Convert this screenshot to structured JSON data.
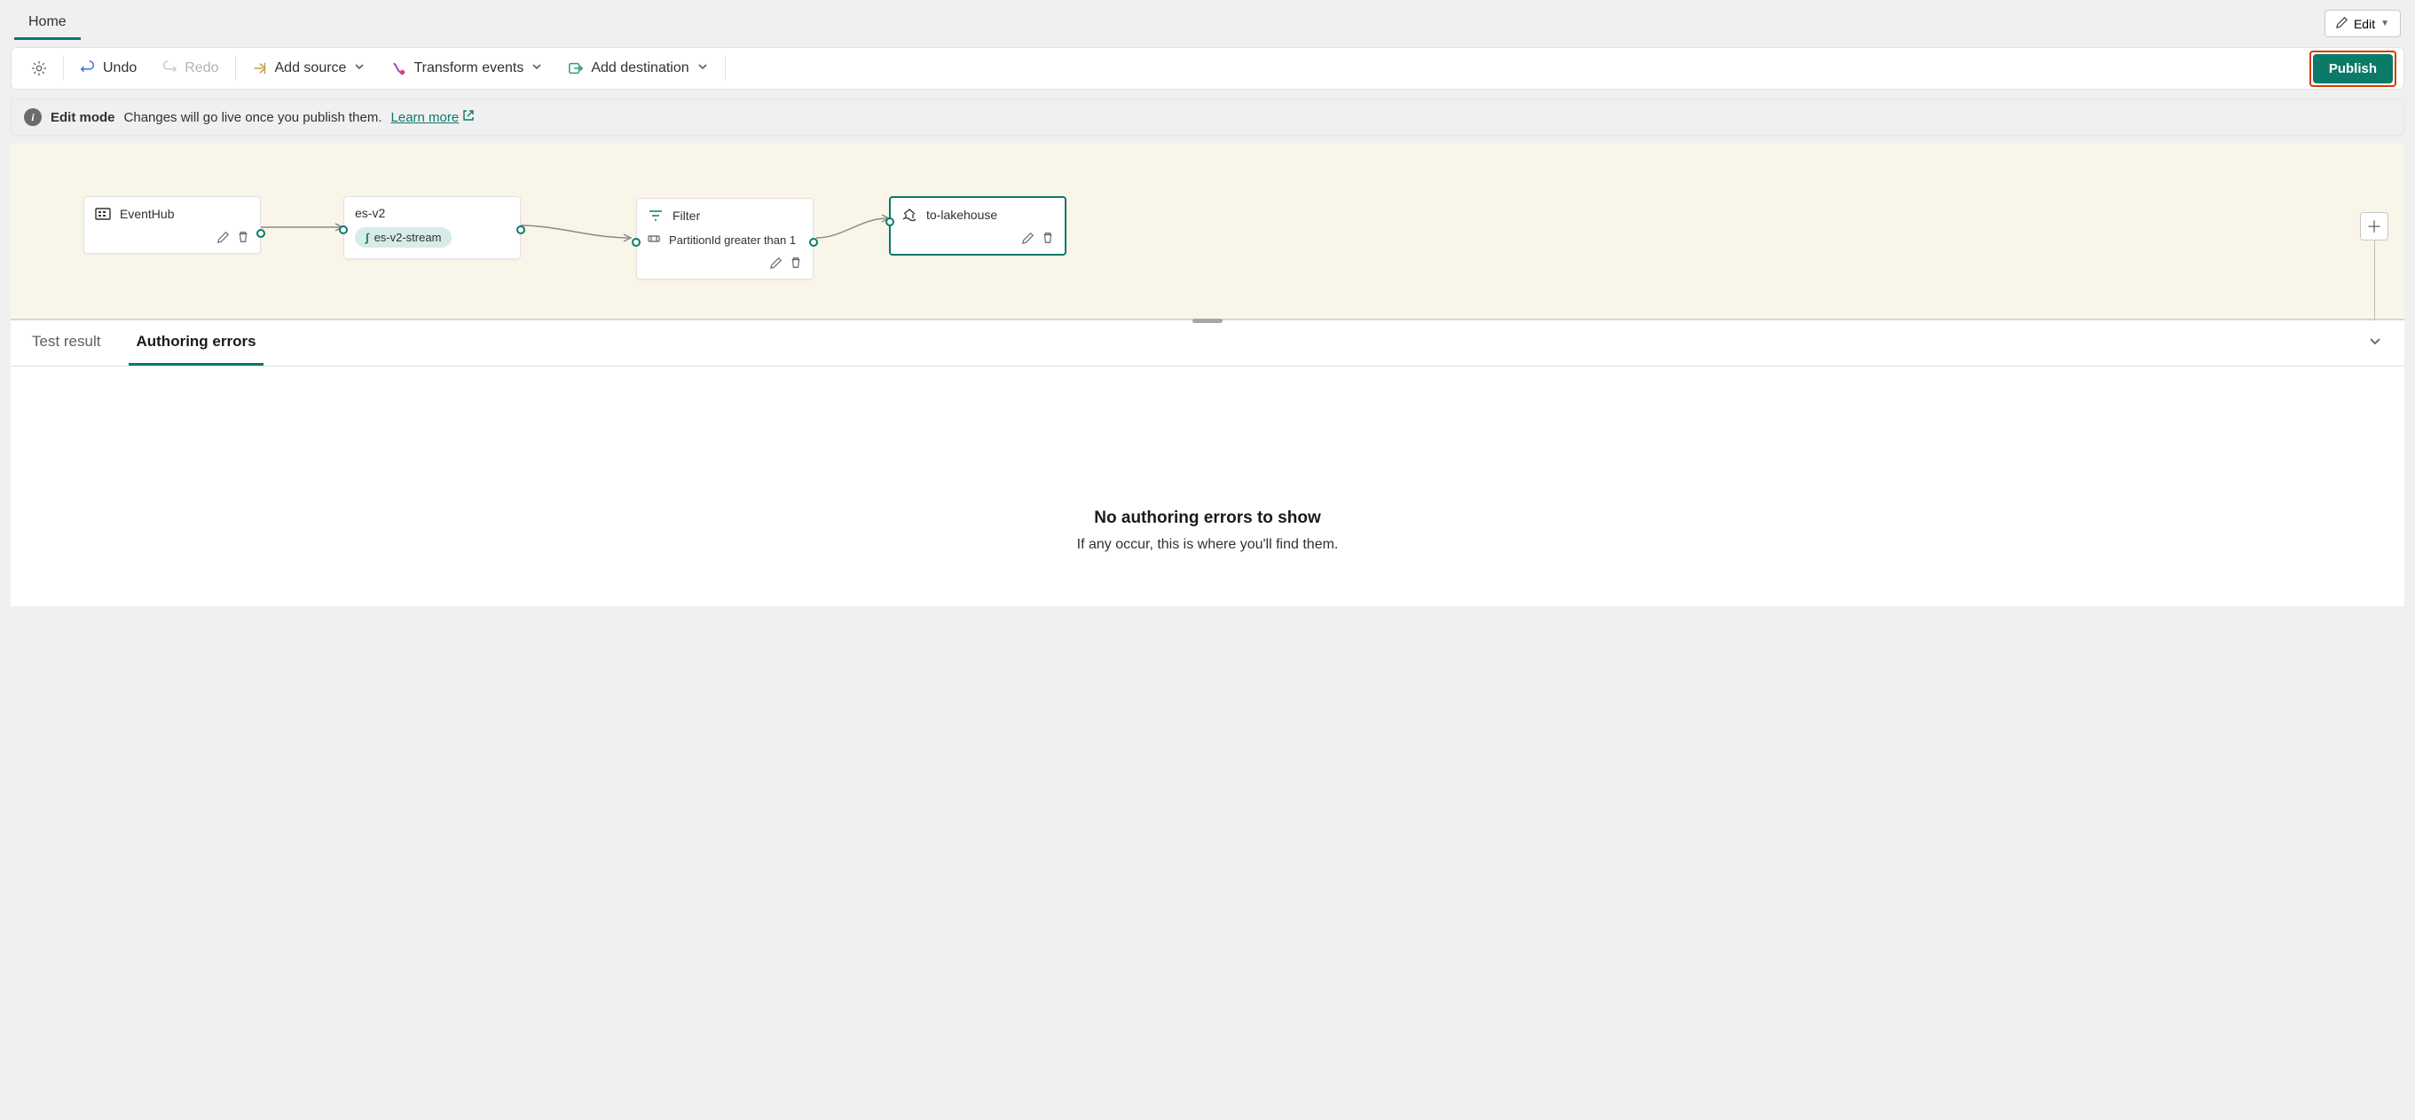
{
  "topTabs": {
    "home": "Home"
  },
  "editButton": "Edit",
  "toolbar": {
    "undo": "Undo",
    "redo": "Redo",
    "addSource": "Add source",
    "transformEvents": "Transform events",
    "addDestination": "Add destination",
    "publish": "Publish"
  },
  "infoBanner": {
    "label": "Edit mode",
    "text": "Changes will go live once you publish them.",
    "link": "Learn more"
  },
  "nodes": {
    "source": {
      "title": "EventHub"
    },
    "stream": {
      "title": "es-v2",
      "chip": "es-v2-stream"
    },
    "filter": {
      "title": "Filter",
      "detail": "PartitionId greater than 1"
    },
    "destination": {
      "title": "to-lakehouse"
    }
  },
  "bottomPanel": {
    "tabs": {
      "testResult": "Test result",
      "authoringErrors": "Authoring errors"
    },
    "emptyTitle": "No authoring errors to show",
    "emptySub": "If any occur, this is where you'll find them."
  }
}
